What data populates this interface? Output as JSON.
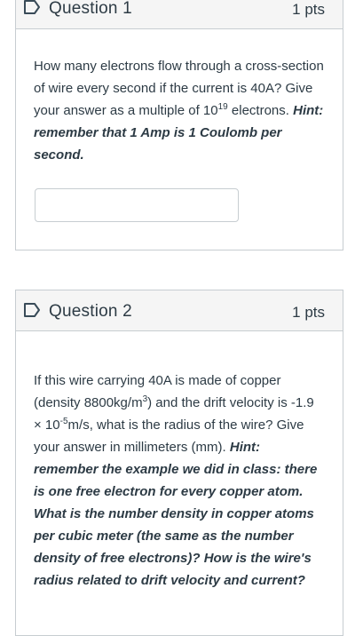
{
  "questions": [
    {
      "title": "Question 1",
      "points": "1 pts",
      "text_a": "How many electrons flow through a cross-section of wire every second if the current is 40A? Give your answer as a multiple of 10",
      "exp_a": "19",
      "text_b": " electrons. ",
      "hint": "Hint: remember that 1 Amp is 1 Coulomb per second.",
      "answer_value": ""
    },
    {
      "title": "Question 2",
      "points": "1 pts",
      "text_a": "If this wire carrying 40A is made of copper (density 8800kg/m",
      "exp_a": "3",
      "text_b": ") and the drift velocity is -1.9 × 10",
      "exp_b": "-5",
      "text_c": "m/s, what is the radius of the wire? Give your answer in millimeters (mm). ",
      "hint": "Hint: remember the example we did in class: there is one free electron for every copper atom. What is the number density in copper atoms per cubic meter (the same as the number density of free electrons)? How is the wire's radius related to drift velocity and current?"
    }
  ],
  "icons": {
    "flag": "flag-bookmark-icon"
  },
  "colors": {
    "flag_icon": "#394b58",
    "border": "#c7cdd1",
    "header_bg": "#f5f5f5",
    "text": "#2d3b45"
  }
}
